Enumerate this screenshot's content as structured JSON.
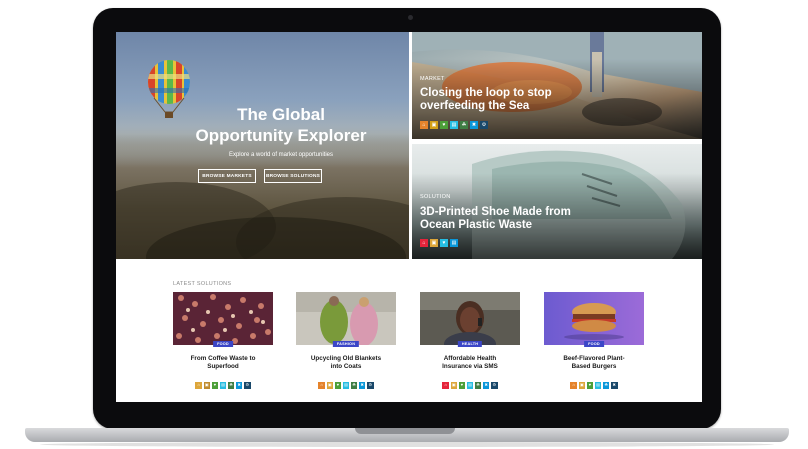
{
  "hero": {
    "title_line1": "The Global",
    "title_line2": "Opportunity Explorer",
    "subtitle": "Explore a world of market opportunities",
    "browse_markets": "BROWSE MARKETS",
    "browse_solutions": "BROWSE SOLUTIONS"
  },
  "cards": [
    {
      "kicker": "MARKET",
      "title_line1": "Closing the loop to stop",
      "title_line2": "overfeeding the Sea",
      "sdgs": [
        {
          "icon": "sdg-1-icon",
          "color": "#e5832b"
        },
        {
          "icon": "sdg-2-icon",
          "color": "#d4a017"
        },
        {
          "icon": "sdg-3-icon",
          "color": "#4c9f38"
        },
        {
          "icon": "sdg-4-icon",
          "color": "#26bde2"
        },
        {
          "icon": "sdg-5-icon",
          "color": "#3f7e44"
        },
        {
          "icon": "sdg-6-icon",
          "color": "#0a97d9"
        },
        {
          "icon": "sdg-7-icon",
          "color": "#19486a"
        }
      ]
    },
    {
      "kicker": "SOLUTION",
      "title_line1": "3D-Printed Shoe Made from",
      "title_line2": "Ocean Plastic Waste",
      "sdgs": [
        {
          "icon": "sdg-1-icon",
          "color": "#e5243b"
        },
        {
          "icon": "sdg-2-icon",
          "color": "#dda63a"
        },
        {
          "icon": "sdg-3-icon",
          "color": "#26bde2"
        },
        {
          "icon": "sdg-4-icon",
          "color": "#0a97d9"
        }
      ]
    }
  ],
  "latest": {
    "label": "LATEST SOLUTIONS",
    "items": [
      {
        "badge": "FOOD",
        "title_line1": "From Coffee Waste to",
        "title_line2": "Superfood",
        "sdgs": [
          "#dda63a",
          "#bf8b2e",
          "#4c9f38",
          "#26bde2",
          "#3f7e44",
          "#0a97d9",
          "#19486a"
        ]
      },
      {
        "badge": "FASHION",
        "title_line1": "Upcycling Old Blankets",
        "title_line2": "into Coats",
        "sdgs": [
          "#e5832b",
          "#dda63a",
          "#4c9f38",
          "#26bde2",
          "#3f7e44",
          "#0a97d9",
          "#19486a"
        ]
      },
      {
        "badge": "HEALTH",
        "title_line1": "Affordable Health",
        "title_line2": "Insurance via SMS",
        "sdgs": [
          "#e5243b",
          "#dda63a",
          "#4c9f38",
          "#26bde2",
          "#3f7e44",
          "#0a97d9",
          "#19486a"
        ]
      },
      {
        "badge": "FOOD",
        "title_line1": "Beef-Flavored Plant-",
        "title_line2": "Based Burgers",
        "sdgs": [
          "#e5832b",
          "#dda63a",
          "#4c9f38",
          "#26bde2",
          "#0a97d9",
          "#19486a"
        ]
      }
    ]
  }
}
